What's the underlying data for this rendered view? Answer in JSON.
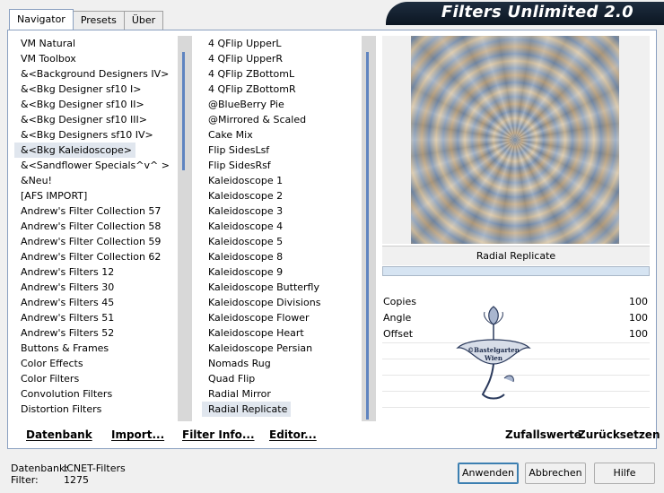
{
  "tabs": [
    "Navigator",
    "Presets",
    "Über"
  ],
  "title": "Filters Unlimited 2.0",
  "categories": [
    "VM Natural",
    "VM Toolbox",
    "&<Background Designers IV>",
    "&<Bkg Designer sf10 I>",
    "&<Bkg Designer sf10 II>",
    "&<Bkg Designer sf10 III>",
    "&<Bkg Designers sf10 IV>",
    "&<Bkg Kaleidoscope>",
    "&<Sandflower Specials^v^ >",
    "&Neu!",
    "[AFS IMPORT]",
    "Andrew's Filter Collection 57",
    "Andrew's Filter Collection 58",
    "Andrew's Filter Collection 59",
    "Andrew's Filter Collection 62",
    "Andrew's Filters 12",
    "Andrew's Filters 30",
    "Andrew's Filters 45",
    "Andrew's Filters 51",
    "Andrew's Filters 52",
    "Buttons & Frames",
    "Color Effects",
    "Color Filters",
    "Convolution Filters",
    "Distortion Filters"
  ],
  "selected_category": "&<Bkg Kaleidoscope>",
  "filters": [
    "4 QFlip UpperL",
    "4 QFlip UpperR",
    "4 QFlip ZBottomL",
    "4 QFlip ZBottomR",
    "@BlueBerry Pie",
    "@Mirrored & Scaled",
    "Cake Mix",
    "Flip SidesLsf",
    "Flip SidesRsf",
    "Kaleidoscope 1",
    "Kaleidoscope 2",
    "Kaleidoscope 3",
    "Kaleidoscope 4",
    "Kaleidoscope 5",
    "Kaleidoscope 8",
    "Kaleidoscope 9",
    "Kaleidoscope Butterfly",
    "Kaleidoscope Divisions",
    "Kaleidoscope Flower",
    "Kaleidoscope Heart",
    "Kaleidoscope Persian",
    "Nomads Rug",
    "Quad Flip",
    "Radial Mirror",
    "Radial Replicate"
  ],
  "selected_filter": "Radial Replicate",
  "preview": {
    "filter_name": "Radial Replicate"
  },
  "params": [
    {
      "label": "Copies",
      "value": "100"
    },
    {
      "label": "Angle",
      "value": "100"
    },
    {
      "label": "Offset",
      "value": "100"
    }
  ],
  "watermark_text": "©Bastelgarten Wien",
  "bottom_buttons": {
    "database": "Datenbank",
    "import": "Import...",
    "filter_info": "Filter Info...",
    "editor": "Editor..."
  },
  "random_values": "Zufallswerte",
  "reset": "Zurücksetzen",
  "status": {
    "database_label": "Datenbank:",
    "database_value": "ICNET-Filters",
    "filter_label": "Filter:",
    "filter_value": "1275"
  },
  "buttons": {
    "apply": "Anwenden",
    "cancel": "Abbrechen",
    "help": "Hilfe"
  },
  "colors": {
    "accent": "#5f84c0",
    "title_bg": "#0c1622",
    "selection": "#e0e6ee"
  }
}
